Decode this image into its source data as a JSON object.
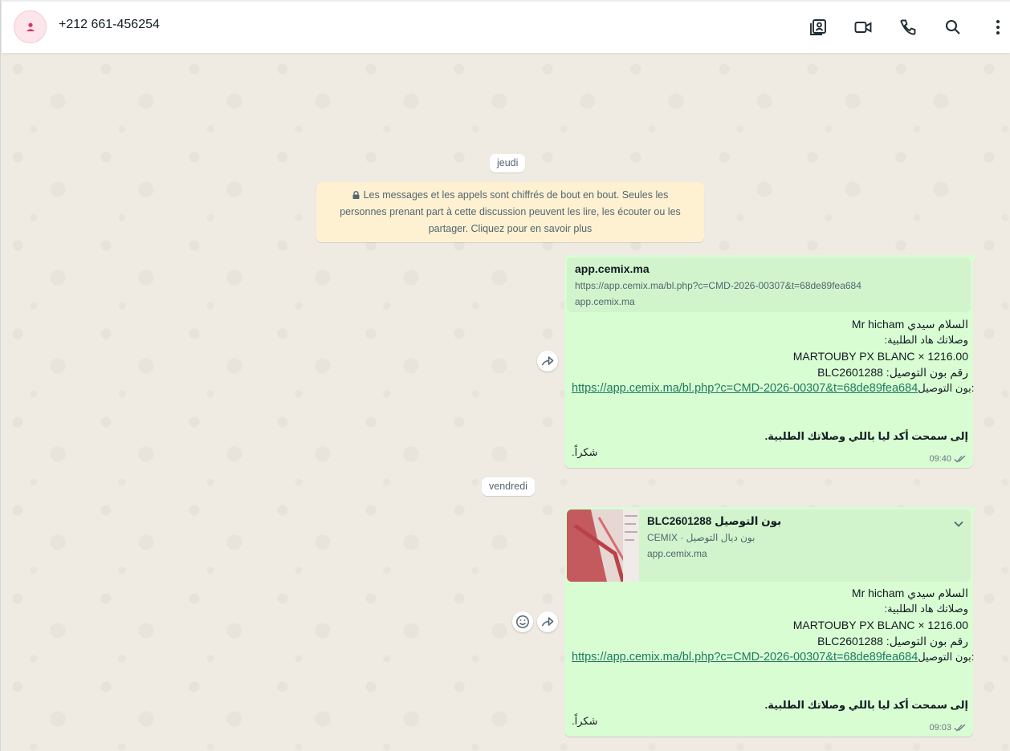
{
  "header": {
    "contact_name": "+212 661-456254",
    "icons": [
      "contacts-icon",
      "video-call-icon",
      "voice-call-icon",
      "search-icon",
      "menu-icon"
    ]
  },
  "chat": {
    "date_chip_1": "jeudi",
    "encryption_notice": "Les messages et les appels sont chiffrés de bout en bout. Seules les personnes prenant part à cette discussion peuvent les lire, les écouter ou les partager. Cliquez pour en savoir plus",
    "date_chip_2": "vendredi",
    "message_1": {
      "preview_title": "app.cemix.ma",
      "preview_url": "https://app.cemix.ma/bl.php?c=CMD-2026-00307&t=68de89fea684",
      "preview_domain": "app.cemix.ma",
      "line_greeting": "السلام سيدي Mr hicham",
      "line_intro": "وصلاتك هاد الطلبية:",
      "line_product": "MARTOUBY PX BLANC × 1216.00",
      "line_bl_number": "رقم بون التوصيل: BLC2601288",
      "link_label": "بون التوصيل:",
      "link_url": "https://app.cemix.ma/bl.php?c=CMD-2026-00307&t=68de89fea684",
      "line_confirm": "إلى سمحت أكد ليا باللي وصلاتك الطلبية.",
      "line_thanks": "شكراً.",
      "time": "09:40"
    },
    "message_2": {
      "preview_title": "بون التوصيل BLC2601288",
      "preview_subtitle": "بون ديال التوصيل · CEMIX",
      "preview_domain": "app.cemix.ma",
      "line_greeting": "السلام سيدي Mr hicham",
      "line_intro": "وصلاتك هاد الطلبية:",
      "line_product": "MARTOUBY PX BLANC × 1216.00",
      "line_bl_number": "رقم بون التوصيل: BLC2601288",
      "link_label": "بون التوصيل:",
      "link_url": "https://app.cemix.ma/bl.php?c=CMD-2026-00307&t=68de89fea684",
      "line_confirm": "إلى سمحت أكد ليا باللي وصلاتك الطلبية.",
      "line_thanks": "شكراً.",
      "time": "09:03"
    }
  },
  "colors": {
    "bubble_out": "#d9fdd3",
    "preview_bg": "#d1f4cc",
    "notice_bg": "#fdf1d2",
    "chat_bg": "#efeae2",
    "link": "#1d7a5f"
  }
}
